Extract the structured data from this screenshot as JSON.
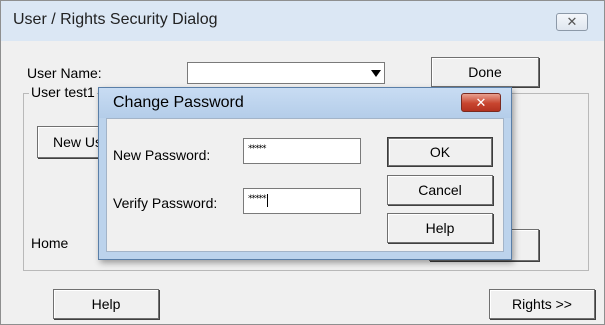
{
  "outer_dialog": {
    "title": "User / Rights Security Dialog",
    "close_glyph": "✕",
    "user_name_label": "User Name:",
    "user_name_value": "",
    "done_label": "Done",
    "group_title": "User test1",
    "new_user_label": "New Us",
    "home_label": "Home",
    "help_label": "Help",
    "rights_label": "Rights >>"
  },
  "change_password_dialog": {
    "title": "Change Password",
    "close_glyph": "✕",
    "new_password_label": "New Password:",
    "new_password_value": "*****",
    "verify_password_label": "Verify Password:",
    "verify_password_value": "*****",
    "ok_label": "OK",
    "cancel_label": "Cancel",
    "help_label": "Help"
  },
  "colors": {
    "title_bar": "#dbe7f4",
    "dialog_frame": "#bcd3ec",
    "close_red": "#c8452f"
  }
}
